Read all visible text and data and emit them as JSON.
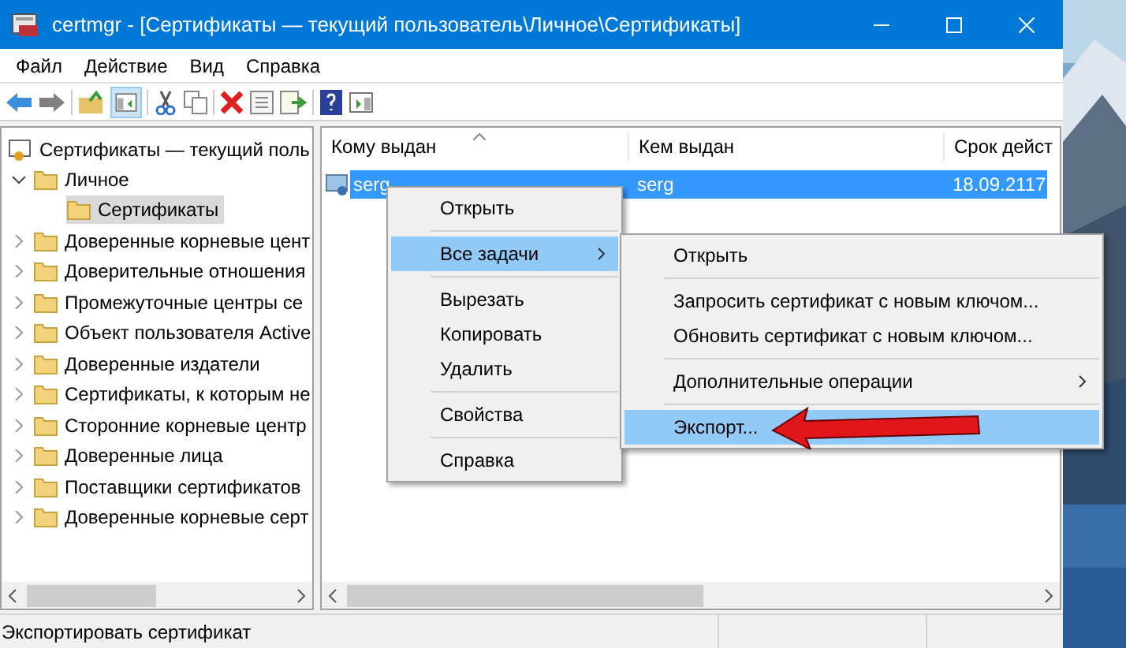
{
  "window": {
    "title": "certmgr - [Сертификаты — текущий пользователь\\Личное\\Сертификаты]"
  },
  "menu_bar": [
    "Файл",
    "Действие",
    "Вид",
    "Справка"
  ],
  "tree": {
    "label": "Сертификаты — текущий поль",
    "children": [
      {
        "label": "Личное",
        "expanded": true,
        "selected": false,
        "children": [
          {
            "label": "Сертификаты",
            "selected": true
          }
        ]
      },
      {
        "label": "Доверенные корневые цент",
        "expanded": false,
        "selected": false
      },
      {
        "label": "Доверительные отношения",
        "expanded": false,
        "selected": false
      },
      {
        "label": "Промежуточные центры се",
        "expanded": false,
        "selected": false
      },
      {
        "label": "Объект пользователя Active",
        "expanded": false,
        "selected": false
      },
      {
        "label": "Доверенные издатели",
        "expanded": false,
        "selected": false
      },
      {
        "label": "Сертификаты, к которым не",
        "expanded": false,
        "selected": false
      },
      {
        "label": "Сторонние корневые центр",
        "expanded": false,
        "selected": false
      },
      {
        "label": "Доверенные лица",
        "expanded": false,
        "selected": false
      },
      {
        "label": "Поставщики сертификатов",
        "expanded": false,
        "selected": false
      },
      {
        "label": "Доверенные корневые серт",
        "expanded": false,
        "selected": false
      }
    ]
  },
  "table": {
    "columns": [
      "Кому выдан",
      "Кем выдан",
      "Срок дейст"
    ],
    "rows": [
      {
        "cells": [
          "serg",
          "serg",
          "18.09.2117"
        ],
        "selected": true
      }
    ]
  },
  "context_menu": {
    "groups": [
      [
        {
          "label": "Открыть",
          "selected": false,
          "submenu": false
        }
      ],
      [
        {
          "label": "Все задачи",
          "selected": true,
          "submenu": true
        }
      ],
      [
        {
          "label": "Вырезать",
          "selected": false,
          "submenu": false
        },
        {
          "label": "Копировать",
          "selected": false,
          "submenu": false
        },
        {
          "label": "Удалить",
          "selected": false,
          "submenu": false
        }
      ],
      [
        {
          "label": "Свойства",
          "selected": false,
          "submenu": false
        }
      ],
      [
        {
          "label": "Справка",
          "selected": false,
          "submenu": false
        }
      ]
    ]
  },
  "submenu": {
    "groups": [
      [
        {
          "label": "Открыть",
          "selected": false,
          "submenu": false
        }
      ],
      [
        {
          "label": "Запросить сертификат с новым ключом...",
          "selected": false,
          "submenu": false
        },
        {
          "label": "Обновить сертификат с новым ключом...",
          "selected": false,
          "submenu": false
        }
      ],
      [
        {
          "label": "Дополнительные операции",
          "selected": false,
          "submenu": true
        }
      ],
      [
        {
          "label": "Экспорт...",
          "selected": true,
          "submenu": false
        }
      ]
    ]
  },
  "status_bar": {
    "text": "Экспортировать сертификат"
  }
}
